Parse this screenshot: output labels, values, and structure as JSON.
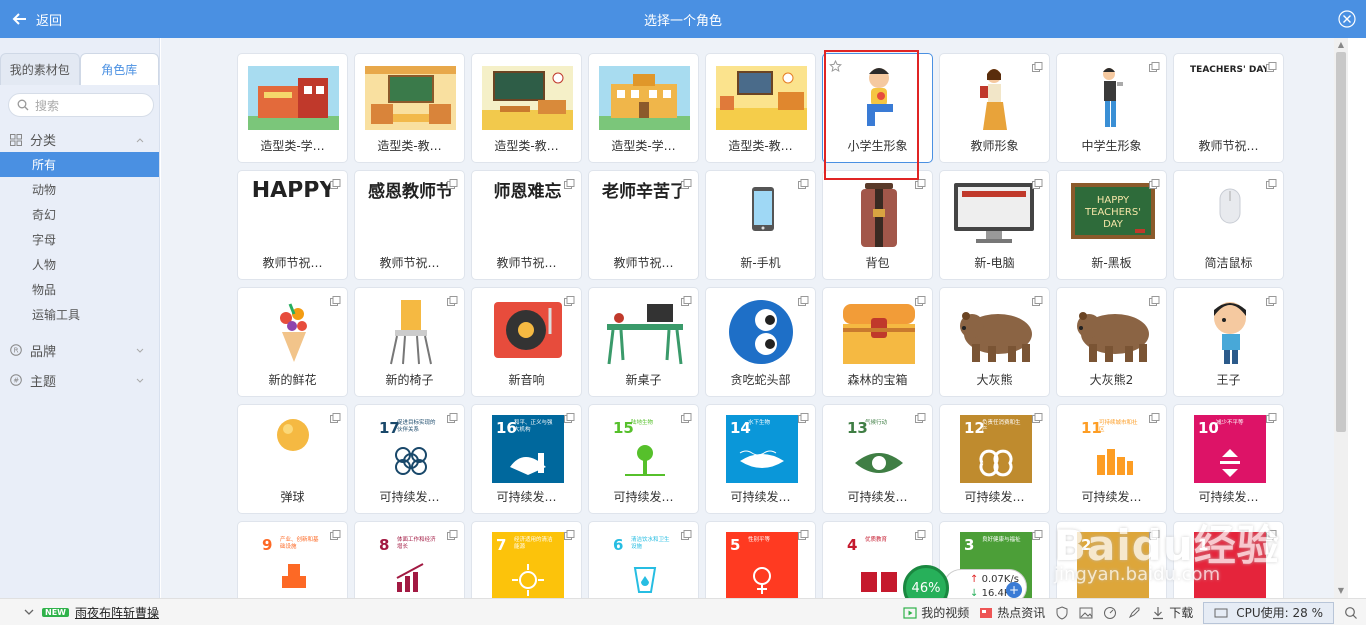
{
  "header": {
    "back_label": "返回",
    "title": "选择一个角色"
  },
  "sidebar": {
    "tabs": [
      {
        "label": "我的素材包",
        "active": false
      },
      {
        "label": "角色库",
        "active": true
      }
    ],
    "search_placeholder": "搜索",
    "group_title": "分类",
    "categories": [
      "所有",
      "动物",
      "奇幻",
      "字母",
      "人物",
      "物品",
      "运输工具"
    ],
    "active_category": "所有",
    "extra_groups": [
      "品牌",
      "主题"
    ]
  },
  "cards": [
    {
      "label": "造型类-学…",
      "thumb": "school-building"
    },
    {
      "label": "造型类-教…",
      "thumb": "classroom-board"
    },
    {
      "label": "造型类-教…",
      "thumb": "classroom-chalkboard"
    },
    {
      "label": "造型类-学…",
      "thumb": "school-yellow"
    },
    {
      "label": "造型类-教…",
      "thumb": "classroom-yellow"
    },
    {
      "label": "小学生形象",
      "thumb": "student-boy",
      "selected": true
    },
    {
      "label": "教师形象",
      "thumb": "teacher-woman"
    },
    {
      "label": "中学生形象",
      "thumb": "student-teen"
    },
    {
      "label": "教师节祝…",
      "thumb": "text",
      "text": "TEACHERS' DAY",
      "small": true
    },
    {
      "label": "教师节祝…",
      "thumb": "text",
      "text": "HAPPY"
    },
    {
      "label": "教师节祝…",
      "thumb": "text",
      "text": "感恩教师节"
    },
    {
      "label": "教师节祝…",
      "thumb": "text",
      "text": "师恩难忘"
    },
    {
      "label": "教师节祝…",
      "thumb": "text",
      "text": "老师辛苦了"
    },
    {
      "label": "新-手机",
      "thumb": "phone"
    },
    {
      "label": "背包",
      "thumb": "backpack"
    },
    {
      "label": "新-电脑",
      "thumb": "computer"
    },
    {
      "label": "新-黑板",
      "thumb": "blackboard",
      "text": "HAPPY TEACHERS' DAY"
    },
    {
      "label": "简洁鼠标",
      "thumb": "mouse"
    },
    {
      "label": "新的鲜花",
      "thumb": "flowers"
    },
    {
      "label": "新的椅子",
      "thumb": "chair"
    },
    {
      "label": "新音响",
      "thumb": "turntable"
    },
    {
      "label": "新桌子",
      "thumb": "desk"
    },
    {
      "label": "贪吃蛇头部",
      "thumb": "snake-head"
    },
    {
      "label": "森林的宝箱",
      "thumb": "treasure"
    },
    {
      "label": "大灰熊",
      "thumb": "bear"
    },
    {
      "label": "大灰熊2",
      "thumb": "bear"
    },
    {
      "label": "王子",
      "thumb": "prince"
    },
    {
      "label": "弹球",
      "thumb": "ball"
    },
    {
      "label": "可持续发…",
      "thumb": "sdg",
      "num": "17",
      "caption": "促进目标实现的伙伴关系",
      "color": "#ffffff",
      "fg": "#19486a"
    },
    {
      "label": "可持续发…",
      "thumb": "sdg",
      "num": "16",
      "caption": "和平、正义与强大机构",
      "color": "#00689d",
      "fg": "#ffffff"
    },
    {
      "label": "可持续发…",
      "thumb": "sdg",
      "num": "15",
      "caption": "陆地生物",
      "color": "#ffffff",
      "fg": "#56c02b"
    },
    {
      "label": "可持续发…",
      "thumb": "sdg",
      "num": "14",
      "caption": "水下生物",
      "color": "#0a97d9",
      "fg": "#ffffff"
    },
    {
      "label": "可持续发…",
      "thumb": "sdg",
      "num": "13",
      "caption": "气候行动",
      "color": "#ffffff",
      "fg": "#3f7e44"
    },
    {
      "label": "可持续发…",
      "thumb": "sdg",
      "num": "12",
      "caption": "负责任消费和生产",
      "color": "#bf8b2e",
      "fg": "#ffffff"
    },
    {
      "label": "可持续发…",
      "thumb": "sdg",
      "num": "11",
      "caption": "可持续城市和社区",
      "color": "#ffffff",
      "fg": "#fd9d24"
    },
    {
      "label": "可持续发…",
      "thumb": "sdg",
      "num": "10",
      "caption": "减少不平等",
      "color": "#dd1367",
      "fg": "#ffffff"
    },
    {
      "label": "",
      "thumb": "sdg",
      "num": "9",
      "caption": "产业、创新和基础设施",
      "color": "#ffffff",
      "fg": "#fd6925"
    },
    {
      "label": "",
      "thumb": "sdg",
      "num": "8",
      "caption": "体面工作和经济增长",
      "color": "#ffffff",
      "fg": "#a21942"
    },
    {
      "label": "",
      "thumb": "sdg",
      "num": "7",
      "caption": "经济适用的清洁能源",
      "color": "#fcc30b",
      "fg": "#ffffff"
    },
    {
      "label": "",
      "thumb": "sdg",
      "num": "6",
      "caption": "清洁饮水和卫生设施",
      "color": "#ffffff",
      "fg": "#26bde2"
    },
    {
      "label": "",
      "thumb": "sdg",
      "num": "5",
      "caption": "性别平等",
      "color": "#ff3a21",
      "fg": "#ffffff"
    },
    {
      "label": "",
      "thumb": "sdg",
      "num": "4",
      "caption": "优质教育",
      "color": "#ffffff",
      "fg": "#c5192d"
    },
    {
      "label": "",
      "thumb": "sdg",
      "num": "3",
      "caption": "良好健康与福祉",
      "color": "#4c9f38",
      "fg": "#ffffff"
    },
    {
      "label": "",
      "thumb": "sdg",
      "num": "2",
      "caption": "",
      "color": "#dda63a",
      "fg": "#ffffff"
    },
    {
      "label": "",
      "thumb": "sdg",
      "num": "1",
      "caption": "",
      "color": "#e5243b",
      "fg": "#ffffff"
    }
  ],
  "statusbar": {
    "new_badge": "NEW",
    "news_text": "雨夜布阵斩曹操",
    "video_label": "我的视频",
    "hot_label": "热点资讯",
    "download_label": "下载",
    "cpu_label": "CPU使用: 28 %"
  },
  "float_widget": {
    "percent": "46%",
    "up_speed": "0.07K/s",
    "down_speed": "16.4K/s"
  },
  "watermark": {
    "text": "Baidu经验",
    "sub": "jingyan.baidu.com"
  },
  "colors": {
    "header": "#4a90e2",
    "accent": "#4a90e2",
    "highlight": "#e02424"
  }
}
